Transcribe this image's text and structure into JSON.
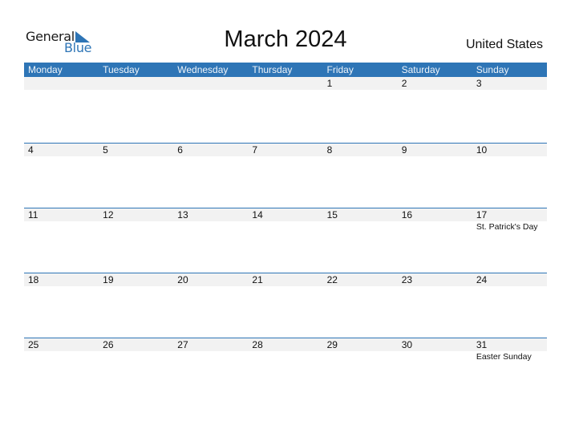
{
  "logo": {
    "word1": "General",
    "word2": "Blue",
    "brand_color": "#2E75B6",
    "icon": "triangle-flag-icon"
  },
  "title": "March 2024",
  "country": "United States",
  "accent_color": "#2E75B6",
  "weekdays": [
    "Monday",
    "Tuesday",
    "Wednesday",
    "Thursday",
    "Friday",
    "Saturday",
    "Sunday"
  ],
  "weeks": [
    {
      "days": [
        {
          "day": "",
          "holiday": ""
        },
        {
          "day": "",
          "holiday": ""
        },
        {
          "day": "",
          "holiday": ""
        },
        {
          "day": "",
          "holiday": ""
        },
        {
          "day": "1",
          "holiday": ""
        },
        {
          "day": "2",
          "holiday": ""
        },
        {
          "day": "3",
          "holiday": ""
        }
      ]
    },
    {
      "days": [
        {
          "day": "4",
          "holiday": ""
        },
        {
          "day": "5",
          "holiday": ""
        },
        {
          "day": "6",
          "holiday": ""
        },
        {
          "day": "7",
          "holiday": ""
        },
        {
          "day": "8",
          "holiday": ""
        },
        {
          "day": "9",
          "holiday": ""
        },
        {
          "day": "10",
          "holiday": ""
        }
      ]
    },
    {
      "days": [
        {
          "day": "11",
          "holiday": ""
        },
        {
          "day": "12",
          "holiday": ""
        },
        {
          "day": "13",
          "holiday": ""
        },
        {
          "day": "14",
          "holiday": ""
        },
        {
          "day": "15",
          "holiday": ""
        },
        {
          "day": "16",
          "holiday": ""
        },
        {
          "day": "17",
          "holiday": "St. Patrick's Day"
        }
      ]
    },
    {
      "days": [
        {
          "day": "18",
          "holiday": ""
        },
        {
          "day": "19",
          "holiday": ""
        },
        {
          "day": "20",
          "holiday": ""
        },
        {
          "day": "21",
          "holiday": ""
        },
        {
          "day": "22",
          "holiday": ""
        },
        {
          "day": "23",
          "holiday": ""
        },
        {
          "day": "24",
          "holiday": ""
        }
      ]
    },
    {
      "days": [
        {
          "day": "25",
          "holiday": ""
        },
        {
          "day": "26",
          "holiday": ""
        },
        {
          "day": "27",
          "holiday": ""
        },
        {
          "day": "28",
          "holiday": ""
        },
        {
          "day": "29",
          "holiday": ""
        },
        {
          "day": "30",
          "holiday": ""
        },
        {
          "day": "31",
          "holiday": "Easter Sunday"
        }
      ]
    }
  ]
}
